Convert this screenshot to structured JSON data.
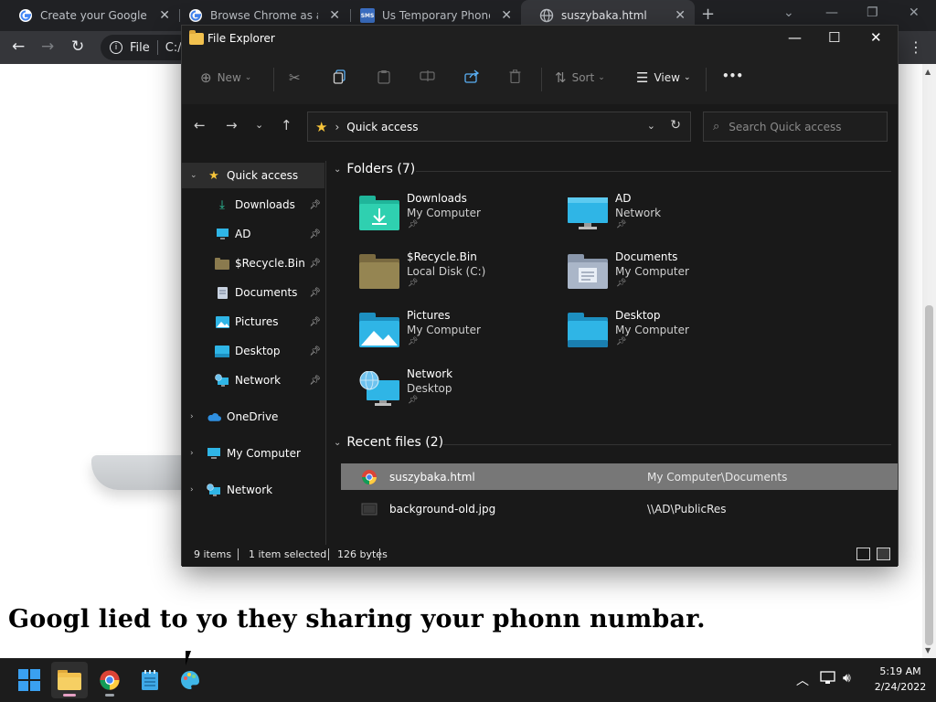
{
  "chrome": {
    "tabs": [
      {
        "title": "Create your Google Ac",
        "icon": "google-icon"
      },
      {
        "title": "Browse Chrome as a gu",
        "icon": "google-icon"
      },
      {
        "title": "Us Temporary Phone N",
        "icon": "sms-icon",
        "icon_text": "SMS"
      },
      {
        "title": "suszybaka.html",
        "icon": "globe-icon"
      }
    ],
    "omnibox": {
      "label": "File",
      "url": "C:/"
    },
    "page": {
      "headline": "Googl lied to yo they sharing your phonn numbar."
    }
  },
  "explorer": {
    "title": "File Explorer",
    "commands": {
      "new": "New",
      "sort": "Sort",
      "view": "View",
      "more": "•••"
    },
    "address": {
      "crumb": "Quick access"
    },
    "search": {
      "placeholder": "Search Quick access"
    },
    "nav": {
      "quick_access": "Quick access",
      "items": [
        "Downloads",
        "AD",
        "$Recycle.Bin",
        "Documents",
        "Pictures",
        "Desktop",
        "Network"
      ],
      "onedrive": "OneDrive",
      "my_computer": "My Computer",
      "network": "Network"
    },
    "folders_header": "Folders (7)",
    "folders": [
      {
        "name": "Downloads",
        "location": "My Computer"
      },
      {
        "name": "AD",
        "location": "Network"
      },
      {
        "name": "$Recycle.Bin",
        "location": "Local Disk (C:)"
      },
      {
        "name": "Documents",
        "location": "My Computer"
      },
      {
        "name": "Pictures",
        "location": "My Computer"
      },
      {
        "name": "Desktop",
        "location": "My Computer"
      },
      {
        "name": "Network",
        "location": "Desktop"
      }
    ],
    "recent_header": "Recent files (2)",
    "recent": [
      {
        "name": "suszybaka.html",
        "path": "My Computer\\Documents",
        "selected": true
      },
      {
        "name": "background-old.jpg",
        "path": "\\\\AD\\PublicRes",
        "selected": false
      }
    ],
    "status": {
      "items": "9 items",
      "selected": "1 item selected",
      "size": "126 bytes"
    }
  },
  "taskbar": {
    "time": "5:19 AM",
    "date": "2/24/2022"
  },
  "colors": {
    "explorer_bg": "#191919",
    "selection": "#777777",
    "accent_star": "#f6c43a",
    "folder_blue": "#2fb5e6"
  }
}
